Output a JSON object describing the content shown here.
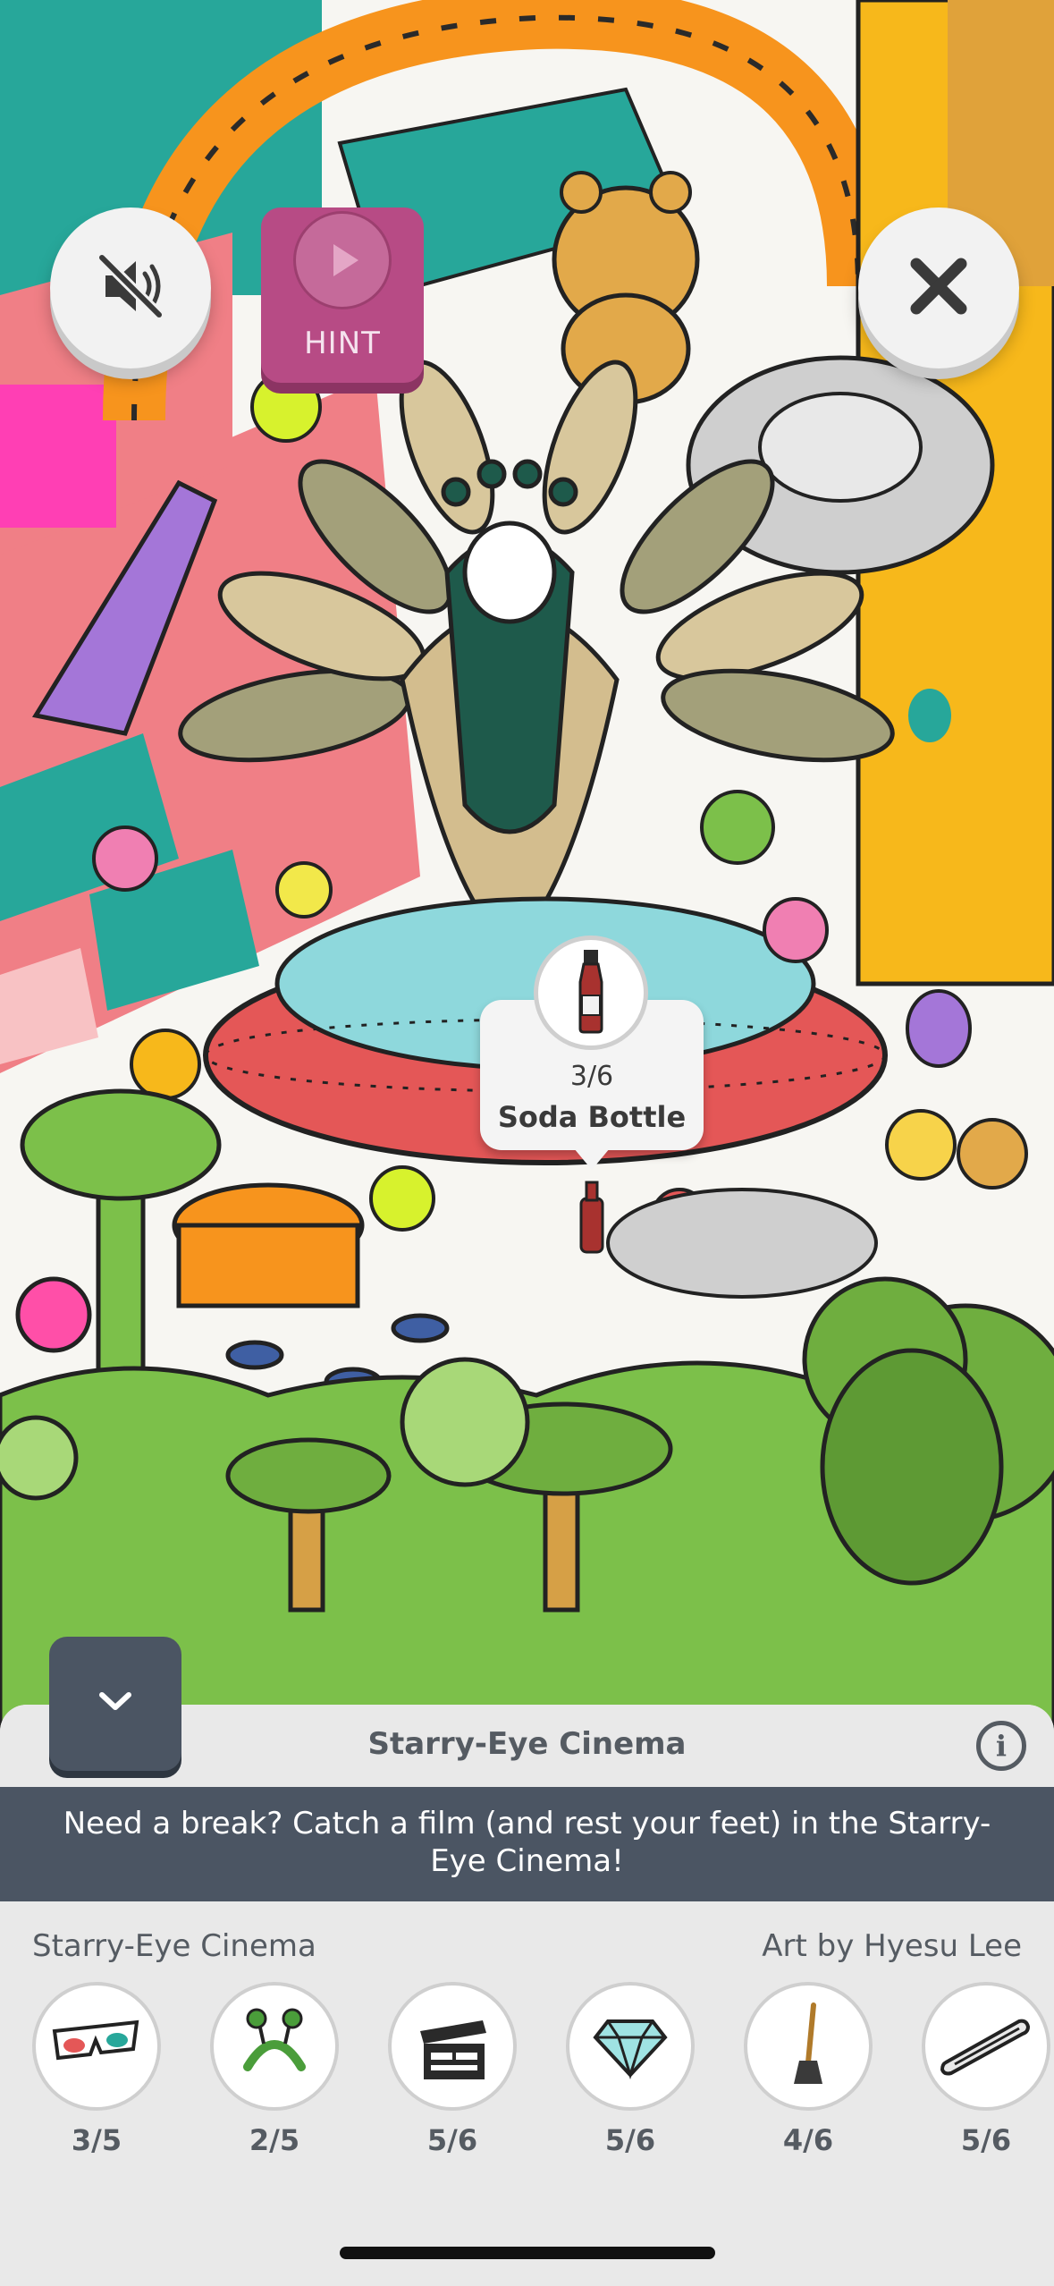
{
  "controls": {
    "mute_icon": "speaker-muted-icon",
    "close_icon": "close-icon",
    "hint_label": "HINT",
    "hint_icon": "play-icon",
    "collapse_icon": "chevron-down-icon"
  },
  "found_popup": {
    "icon": "soda-bottle-icon",
    "count": "3/6",
    "name": "Soda Bottle"
  },
  "panel": {
    "title": "Starry-Eye Cinema",
    "info_icon": "info-icon",
    "info_glyph": "i",
    "description": "Need a break? Catch a film (and rest your feet) in the Starry-Eye Cinema!",
    "location": "Starry-Eye Cinema",
    "artist": "Art by Hyesu Lee"
  },
  "items": [
    {
      "icon": "3d-glasses-icon",
      "count": "3/5"
    },
    {
      "icon": "headband-antenna-icon",
      "count": "2/5"
    },
    {
      "icon": "clapperboard-icon",
      "count": "5/6"
    },
    {
      "icon": "diamond-icon",
      "count": "5/6"
    },
    {
      "icon": "broom-icon",
      "count": "4/6"
    },
    {
      "icon": "straw-icon",
      "count": "5/6"
    }
  ],
  "colors": {
    "panel_bg": "#e9e9e9",
    "banner_bg": "#4b5563",
    "hint_bg": "#b74b85",
    "grass": "#7cc04a",
    "text_gray": "#555b62"
  }
}
